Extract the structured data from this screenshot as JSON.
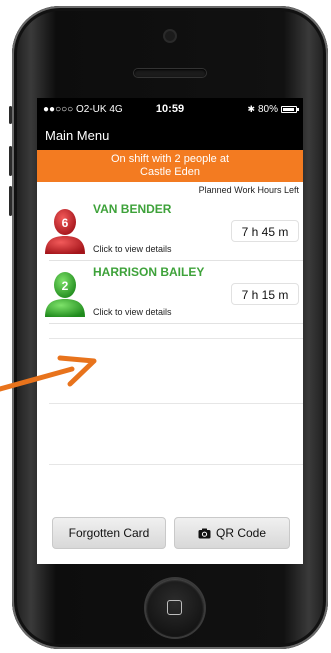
{
  "status_bar": {
    "carrier": "●●○○○ O2-UK  4G",
    "time": "10:59",
    "battery": "80%"
  },
  "nav": {
    "title": "Main Menu"
  },
  "banner": {
    "line1": "On shift with 2 people at",
    "line2": "Castle Eden"
  },
  "list_header": "Planned Work Hours Left",
  "people": [
    {
      "name": "VAN BENDER",
      "badge": "6",
      "hours": "7 h 45 m",
      "details": "Click to view details",
      "color": "#d7262c"
    },
    {
      "name": "HARRISON BAILEY",
      "badge": "2",
      "hours": "7 h 15 m",
      "details": "Click to view details",
      "color": "#3cb43a"
    }
  ],
  "buttons": {
    "forgotten_card": "Forgotten Card",
    "qr_code": "QR Code"
  },
  "colors": {
    "banner": "#f37b21",
    "name_text": "#3ea23a",
    "arrow": "#e8731c"
  }
}
